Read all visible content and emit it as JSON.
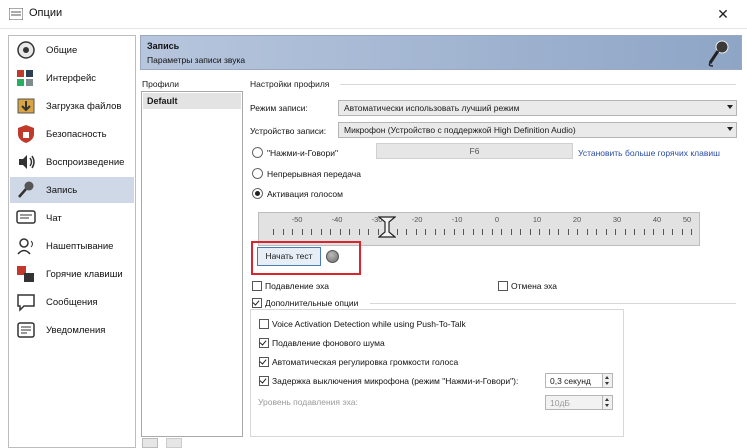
{
  "window": {
    "title": "Опции"
  },
  "sidebar": {
    "items": [
      {
        "label": "Общие",
        "icon": "general-icon"
      },
      {
        "label": "Интерфейс",
        "icon": "interface-icon"
      },
      {
        "label": "Загрузка файлов",
        "icon": "download-icon"
      },
      {
        "label": "Безопасность",
        "icon": "security-icon"
      },
      {
        "label": "Воспроизведение",
        "icon": "playback-icon"
      },
      {
        "label": "Запись",
        "icon": "microphone-icon",
        "selected": true
      },
      {
        "label": "Чат",
        "icon": "chat-icon"
      },
      {
        "label": "Нашептывание",
        "icon": "whisper-icon"
      },
      {
        "label": "Горячие клавиши",
        "icon": "hotkeys-icon"
      },
      {
        "label": "Сообщения",
        "icon": "messages-icon"
      },
      {
        "label": "Уведомления",
        "icon": "notifications-icon"
      }
    ]
  },
  "header": {
    "title": "Запись",
    "subtitle": "Параметры записи звука"
  },
  "profiles": {
    "label": "Профили",
    "items": [
      "Default"
    ]
  },
  "settings": {
    "label": "Настройки профиля",
    "record_mode_label": "Режим записи:",
    "record_mode_value": "Автоматически использовать лучший режим",
    "device_label": "Устройство записи:",
    "device_value": "Микрофон (Устройство с поддержкой High Definition Audio)",
    "ptt_label": "\"Нажми-и-Говори\"",
    "ptt_key": "F6",
    "hotkeys_link": "Установить больше горячих клавиш",
    "continuous_label": "Непрерывная передача",
    "voice_activation_label": "Активация голосом",
    "selected_mode": "voice_activation",
    "scale_labels": [
      "-50",
      "-40",
      "-30",
      "-20",
      "-10",
      "0",
      "10",
      "20",
      "30",
      "40",
      "50"
    ],
    "voice_threshold": -30,
    "test_button": "Начать тест",
    "echo_suppression_label": "Подавление эха",
    "echo_cancel_label": "Отмена эха",
    "advanced_label": "Дополнительные опции",
    "vad_ptt_label": "Voice Activation Detection while using Push-To-Talk",
    "noise_suppression_label": "Подавление фонового шума",
    "agc_label": "Автоматическая регулировка громкости голоса",
    "mic_delay_label": "Задержка выключения микрофона (режим \"Нажми-и-Говори\"):",
    "mic_delay_value": "0,3 секунд",
    "echo_level_label": "Уровень подавления эха:",
    "echo_level_value": "10дБ"
  },
  "colors": {
    "header_start": "#b7c6dd",
    "header_end": "#8ea5c6",
    "highlight": "#d9262e",
    "link": "#2a4da3",
    "selected_row": "#cfd8e6"
  }
}
